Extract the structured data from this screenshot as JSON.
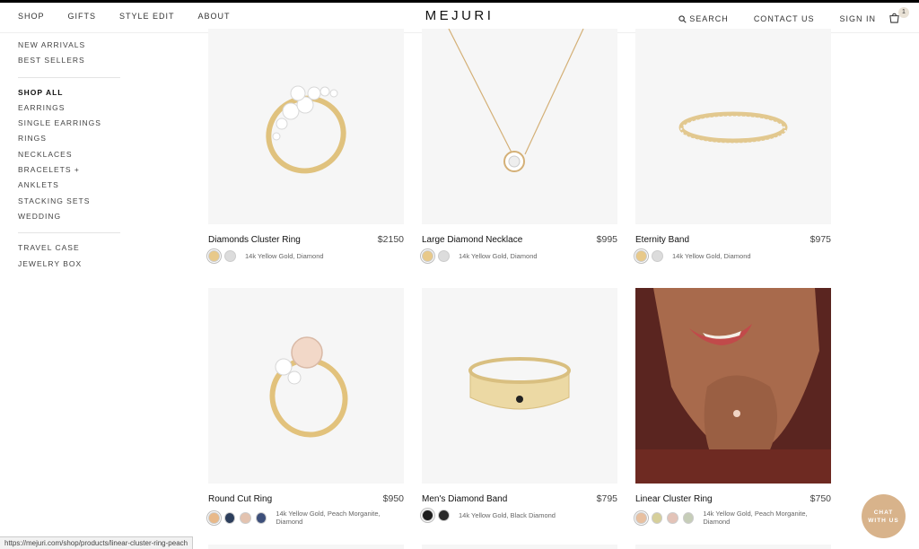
{
  "header": {
    "nav_left": [
      "SHOP",
      "GIFTS",
      "STYLE EDIT",
      "ABOUT"
    ],
    "logo": "MEJURI",
    "search_label": "SEARCH",
    "contact_label": "CONTACT US",
    "signin_label": "SIGN IN",
    "cart_count": "1"
  },
  "sidebar": {
    "group1": [
      "NEW ARRIVALS",
      "BEST SELLERS"
    ],
    "group2": [
      "SHOP ALL",
      "EARRINGS",
      "SINGLE EARRINGS",
      "RINGS",
      "NECKLACES",
      "BRACELETS + ANKLETS",
      "STACKING SETS",
      "WEDDING"
    ],
    "group3": [
      "TRAVEL CASE",
      "JEWELRY BOX"
    ]
  },
  "products": [
    {
      "name": "Diamonds Cluster Ring",
      "price": "$2150",
      "material": "14k Yellow Gold, Diamond",
      "swatches": [
        "#e8c98a",
        "#dcdcdc"
      ]
    },
    {
      "name": "Large Diamond Necklace",
      "price": "$995",
      "material": "14k Yellow Gold, Diamond",
      "swatches": [
        "#e8c98a",
        "#dcdcdc"
      ]
    },
    {
      "name": "Eternity Band",
      "price": "$975",
      "material": "14k Yellow Gold, Diamond",
      "swatches": [
        "#e8c98a",
        "#dcdcdc"
      ]
    },
    {
      "name": "Round Cut Ring",
      "price": "$950",
      "material": "14k Yellow Gold, Peach Morganite, Diamond",
      "swatches": [
        "#e8b98a",
        "#2c3e5c",
        "#e3c3b0",
        "#3d4f7a"
      ]
    },
    {
      "name": "Men's Diamond Band",
      "price": "$795",
      "material": "14k Yellow Gold, Black Diamond",
      "swatches": [
        "#1e1e1e",
        "#2a2a2a"
      ]
    },
    {
      "name": "Linear Cluster Ring",
      "price": "$750",
      "material": "14k Yellow Gold, Peach Morganite, Diamond",
      "swatches": [
        "#e8c0a0",
        "#d6cf9a",
        "#e3c3b8",
        "#c6cdb8"
      ]
    }
  ],
  "chat": {
    "line1": "CHAT",
    "line2": "WITH US"
  },
  "status_url": "https://mejuri.com/shop/products/linear-cluster-ring-peach"
}
